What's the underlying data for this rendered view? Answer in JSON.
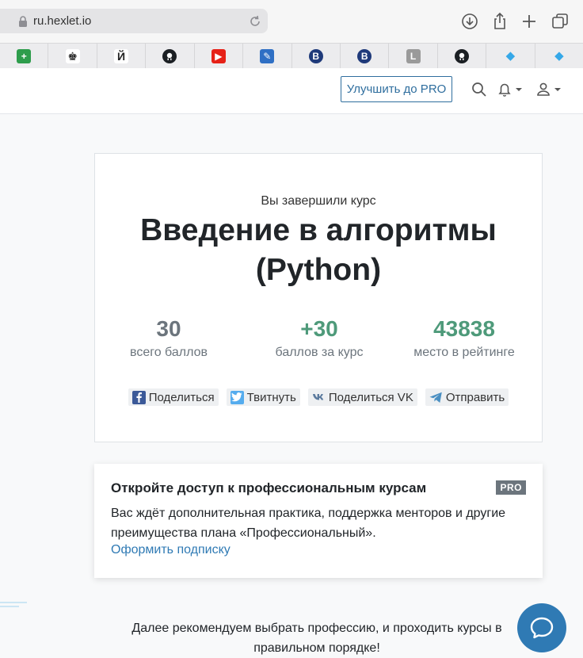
{
  "browser": {
    "url": "ru.hexlet.io",
    "icons": [
      "lock-icon",
      "reload-icon",
      "download-icon",
      "share-icon",
      "new-tab-icon",
      "tabs-icon"
    ]
  },
  "bookmarks": [
    {
      "name": "green-plus",
      "glyph": "+",
      "bg": "#2e9d4c"
    },
    {
      "name": "eagle-emblem",
      "glyph": "♚",
      "bg": "#ffffff"
    },
    {
      "name": "letter-i",
      "glyph": "Й",
      "bg": "#ffffff"
    },
    {
      "name": "github",
      "glyph": "",
      "bg": "#1b1f23"
    },
    {
      "name": "youtube",
      "glyph": "▶",
      "bg": "#e62117"
    },
    {
      "name": "blue-app",
      "glyph": "✎",
      "bg": "#2f6fc4"
    },
    {
      "name": "hse-1",
      "glyph": "В",
      "bg": "#1f3a7a"
    },
    {
      "name": "hse-2",
      "glyph": "В",
      "bg": "#1f3a7a"
    },
    {
      "name": "letter-l",
      "glyph": "L",
      "bg": "#9a9a9a"
    },
    {
      "name": "github-2",
      "glyph": "",
      "bg": "#1b1f23"
    },
    {
      "name": "diamond",
      "glyph": "◆",
      "bg": "#ececee"
    },
    {
      "name": "diamond-2",
      "glyph": "◆",
      "bg": "#ececee"
    }
  ],
  "header": {
    "pro_button": "Улучшить до PRO"
  },
  "course": {
    "subtitle": "Вы завершили курс",
    "title": "Введение в алгоритмы (Python)"
  },
  "stats": [
    {
      "value": "30",
      "label": "всего баллов",
      "color": "#6c757d"
    },
    {
      "value": "+30",
      "label": "баллов за курс",
      "color": "#4e9a7a"
    },
    {
      "value": "43838",
      "label": "место в рейтинге",
      "color": "#4e9a7a"
    }
  ],
  "share": [
    {
      "label": "Поделиться",
      "icon": "facebook-icon"
    },
    {
      "label": "Твитнуть",
      "icon": "twitter-icon"
    },
    {
      "label": "Поделиться VK",
      "icon": "vk-icon"
    },
    {
      "label": "Отправить",
      "icon": "telegram-icon"
    }
  ],
  "pro_card": {
    "title": "Откройте доступ к профессиональным курсам",
    "badge": "PRO",
    "text": "Вас ждёт дополнительная практика, поддержка менторов и другие преимущества плана «Профессиональный».",
    "link": "Оформить подписку"
  },
  "bottom": {
    "text": "Далее рекомендуем выбрать профессию, и проходить курсы в правильном порядке!"
  },
  "colors": {
    "accent": "#2f7ab4",
    "success": "#4e9a7a",
    "muted": "#6c757d"
  }
}
